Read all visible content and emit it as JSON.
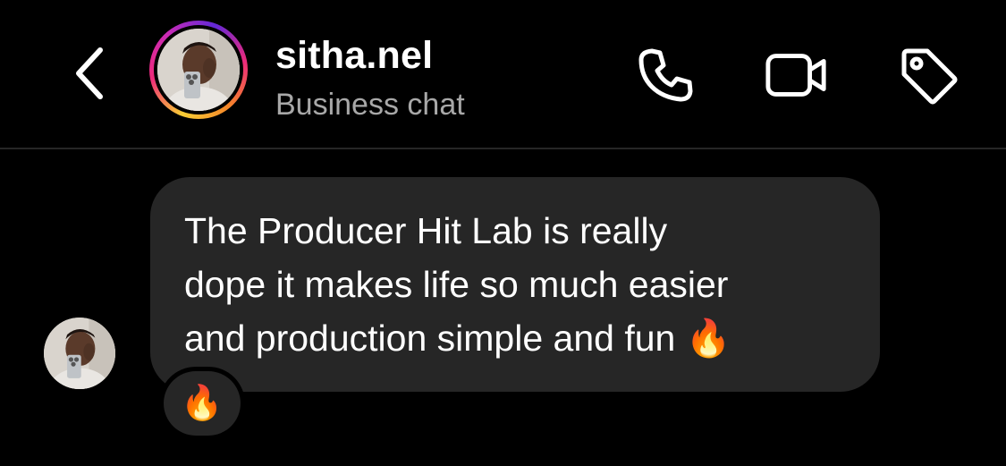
{
  "header": {
    "back_icon": "chevron-left-icon",
    "username": "sitha.nel",
    "subtitle": "Business chat",
    "actions": [
      {
        "name": "call",
        "icon": "phone-icon"
      },
      {
        "name": "video",
        "icon": "video-camera-icon"
      },
      {
        "name": "tag",
        "icon": "tag-icon"
      }
    ]
  },
  "messages": [
    {
      "text": "The Producer Hit Lab is really\ndope it makes life so much easier\nand production simple and fun 🔥",
      "reaction": "🔥"
    }
  ],
  "colors": {
    "background": "#000000",
    "bubble": "#262626",
    "subtitle": "#a8a8a8",
    "divider": "#262626"
  }
}
